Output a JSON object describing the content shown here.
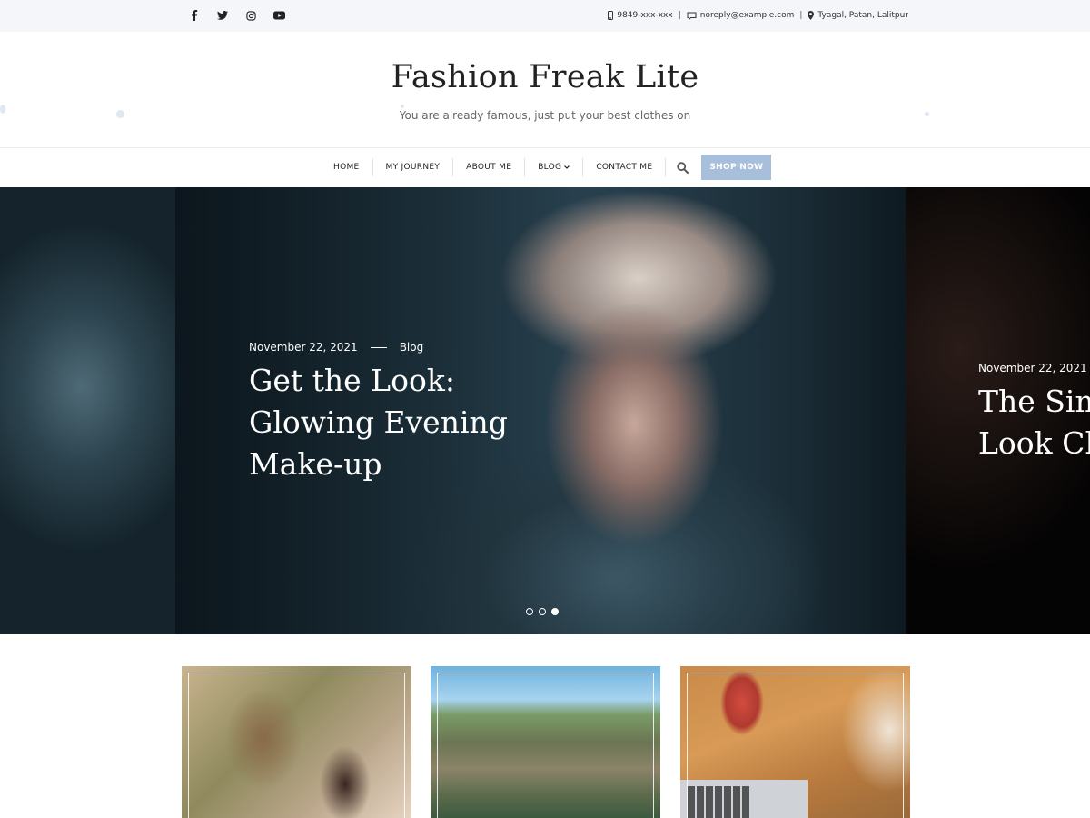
{
  "topbar": {
    "social_icons": [
      "facebook-icon",
      "twitter-icon",
      "instagram-icon",
      "youtube-icon"
    ],
    "phone": "9849-xxx-xxx",
    "email": "noreply@example.com",
    "address": "Tyagal, Patan, Lalitpur",
    "separator": "|"
  },
  "header": {
    "site_title": "Fashion Freak Lite",
    "tagline": "You are already famous, just put your best clothes on"
  },
  "nav": {
    "items": [
      "HOME",
      "MY JOURNEY",
      "ABOUT ME",
      "BLOG",
      "CONTACT ME"
    ],
    "shop_label": "SHOP NOW",
    "accent_color": "#a8bfdc"
  },
  "slider": {
    "main": {
      "date": "November 22, 2021",
      "category": "Blog",
      "title_lines": [
        "Get the Look:",
        "Glowing Evening",
        "Make-up"
      ]
    },
    "next": {
      "date": "November 22, 2021",
      "title_lines": [
        "The Sim",
        "Look Ch"
      ]
    },
    "pagination": {
      "count": 3,
      "active": 3
    }
  },
  "cards": [
    {
      "image": "woman-in-forest-photo"
    },
    {
      "image": "woman-at-lake-photo"
    },
    {
      "image": "woman-with-laptop-photo"
    }
  ]
}
